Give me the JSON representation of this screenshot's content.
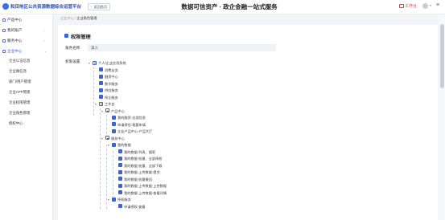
{
  "header": {
    "platform_name": "和田地区公共资源数据综合运营平台",
    "back_label": "返回首页",
    "title": "数据可信资产 · 政企金融一站式服务",
    "workbench_label": "工作台"
  },
  "sidebar": {
    "items": [
      {
        "label": "产品中心",
        "expanded": false
      },
      {
        "label": "我的账户",
        "expanded": false
      },
      {
        "label": "服务中心",
        "expanded": false
      },
      {
        "label": "企业中心",
        "expanded": true
      }
    ],
    "sub_items": [
      {
        "label": "企业认证信息"
      },
      {
        "label": "企业微信息"
      },
      {
        "label": "部门/用户管理"
      },
      {
        "label": "企业APP管理"
      },
      {
        "label": "企业权限管理"
      },
      {
        "label": "企业角色管理"
      },
      {
        "label": "授权中心"
      }
    ]
  },
  "breadcrumb": {
    "parent": "企业中心",
    "separator": " / ",
    "current": "企业角色管理"
  },
  "form": {
    "title": "权限管理",
    "role_label": "角色名称",
    "role_value": "法人",
    "perm_label": "权限设置"
  },
  "tree": [
    {
      "label": "个人/企业应用系统",
      "level": 0,
      "toggle": "▾",
      "state": "partial"
    },
    {
      "label": "消费业务",
      "level": 1,
      "toggle": "",
      "state": "checked"
    },
    {
      "label": "融资中心",
      "level": 1,
      "toggle": "",
      "state": "checked"
    },
    {
      "label": "数字服务",
      "level": 1,
      "toggle": "",
      "state": "checked"
    },
    {
      "label": "供应服务",
      "level": 1,
      "toggle": "",
      "state": "checked"
    },
    {
      "label": "授企服务",
      "level": 1,
      "toggle": "",
      "state": "checked"
    },
    {
      "label": "工作台",
      "level": 1,
      "toggle": "▾",
      "state": "partial"
    },
    {
      "label": "产品中心",
      "level": 2,
      "toggle": "▾",
      "state": "partial"
    },
    {
      "label": "我的融资-全部信息",
      "level": 3,
      "toggle": "",
      "state": "checked"
    },
    {
      "label": "申请授信-我要申请",
      "level": 3,
      "toggle": "",
      "state": "checked"
    },
    {
      "label": "企业产品中心-产品大厅",
      "level": 3,
      "toggle": "",
      "state": "checked"
    },
    {
      "label": "服务中心",
      "level": 2,
      "toggle": "▾",
      "state": "partial"
    },
    {
      "label": "我的数据",
      "level": 3,
      "toggle": "▾",
      "state": "checked"
    },
    {
      "label": "我的数据-列表、搜索",
      "level": 4,
      "toggle": "",
      "state": "checked"
    },
    {
      "label": "我的数据-批量、全部授权",
      "level": 4,
      "toggle": "",
      "state": "checked"
    },
    {
      "label": "我的数据-批量、全部下载",
      "level": 4,
      "toggle": "",
      "state": "checked"
    },
    {
      "label": "我的数据-上传数据-提交",
      "level": 4,
      "toggle": "",
      "state": "checked"
    },
    {
      "label": "我的数据-批量撤回",
      "level": 4,
      "toggle": "",
      "state": "checked"
    },
    {
      "label": "我的数据-上传数据-上传数据",
      "level": 4,
      "toggle": "",
      "state": "checked"
    },
    {
      "label": "我的数据-上传数据-查看详情",
      "level": 4,
      "toggle": "",
      "state": "checked"
    },
    {
      "label": "授权服务",
      "level": 3,
      "toggle": "▾",
      "state": "checked"
    },
    {
      "label": "申请授权-查看",
      "level": 4,
      "toggle": "",
      "state": "checked"
    }
  ],
  "colors": {
    "accent": "#3b63d6",
    "workbench": "#e0413a",
    "background": "#f2f4f9"
  }
}
